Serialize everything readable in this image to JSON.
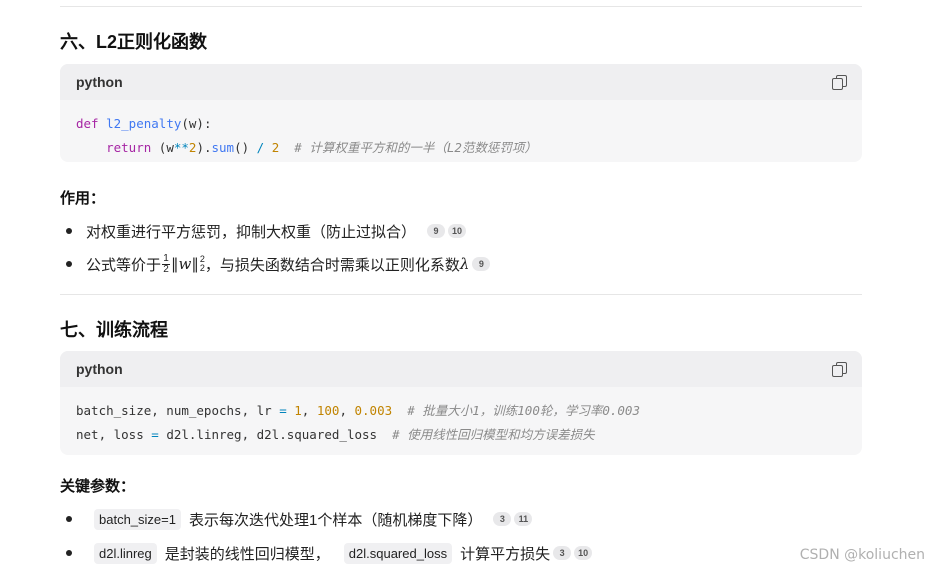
{
  "sections": [
    {
      "title": "六、L2正则化函数",
      "code": {
        "lang": "python",
        "line1": {
          "kw": "def",
          "fn": "l2_penalty",
          "rest": "(w):"
        },
        "line2": {
          "indent": "    ",
          "kw": "return",
          "a": " (w",
          "op1": "**",
          "n1": "2",
          "b": ").",
          "fn": "sum",
          "c": "() ",
          "op2": "/",
          "sp": " ",
          "n2": "2",
          "comment": "  # 计算权重平方和的一半（L2范数惩罚项）"
        }
      },
      "sub_heading": "作用：",
      "bullets": [
        {
          "text": "对权重进行平方惩罚，抑制大权重（防止过拟合）",
          "refs": [
            "9",
            "10"
          ]
        },
        {
          "prefix": "公式等价于",
          "frac_num": "1",
          "frac_den": "2",
          "norm_open": "‖",
          "var": "w",
          "norm_close": "‖",
          "sup": "2",
          "sub": "2",
          "suffix": "，与损失函数结合时需乘以正则化系数",
          "lambda": "λ",
          "refs": [
            "9"
          ]
        }
      ]
    },
    {
      "title": "七、训练流程",
      "code": {
        "lang": "python",
        "line1": {
          "a": "batch_size, num_epochs, lr ",
          "op": "=",
          "sp": " ",
          "n1": "1",
          "c1": ", ",
          "n2": "100",
          "c2": ", ",
          "n3": "0.003",
          "comment": "  # 批量大小1，训练100轮，学习率0.003"
        },
        "line2": {
          "a": "net, loss ",
          "op": "=",
          "b": " d2l.linreg, d2l.squared_loss",
          "comment": "  # 使用线性回归模型和均方误差损失"
        }
      },
      "sub_heading": "关键参数：",
      "bullets": [
        {
          "code": "batch_size=1",
          "text": "表示每次迭代处理1个样本（随机梯度下降）",
          "refs": [
            "3",
            "11"
          ]
        },
        {
          "code": "d2l.linreg",
          "text": "是封装的线性回归模型，",
          "code2": "d2l.squared_loss",
          "text2": "计算平方损失",
          "refs": [
            "3",
            "10"
          ]
        }
      ]
    }
  ],
  "watermark": "CSDN @koliuchen"
}
